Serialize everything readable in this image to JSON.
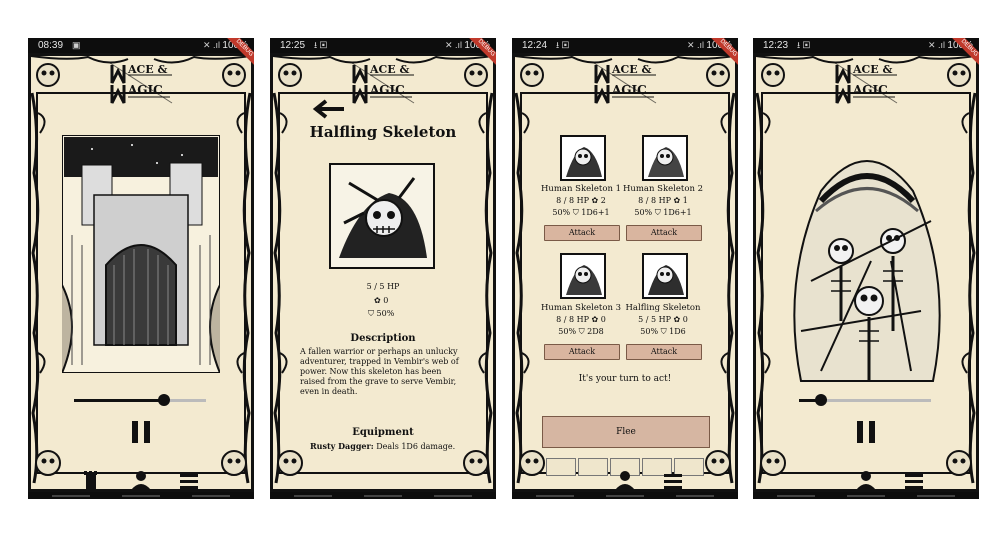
{
  "screens": [
    {
      "status": {
        "time": "08:39",
        "battery": "100%"
      },
      "debug": "DEBUG"
    },
    {
      "status": {
        "time": "12:25",
        "battery": "100%"
      },
      "debug": "DEBUG",
      "title": "Halfling Skeleton",
      "hp": "5 / 5 HP",
      "armor": "0",
      "dodge": "50%",
      "description_heading": "Description",
      "description": "A fallen warrior or perhaps an unlucky adventurer, trapped in Vembir's web of power. Now this skeleton has been raised from the grave to serve Vembir, even in death.",
      "equipment_heading": "Equipment",
      "equipment_name": "Rusty Dagger:",
      "equipment_effect": "Deals 1D6 damage."
    },
    {
      "status": {
        "time": "12:24",
        "battery": "100%"
      },
      "debug": "DEBUG",
      "enemies": [
        {
          "name": "Human Skeleton 1",
          "hp": "8 / 8 HP",
          "armor": "2",
          "dodge": "50%",
          "damage": "1D6+1",
          "button": "Attack"
        },
        {
          "name": "Human Skeleton 2",
          "hp": "8 / 8 HP",
          "armor": "1",
          "dodge": "50%",
          "damage": "1D6+1",
          "button": "Attack"
        },
        {
          "name": "Human Skeleton 3",
          "hp": "8 / 8 HP",
          "armor": "0",
          "dodge": "50%",
          "damage": "2D8",
          "button": "Attack"
        },
        {
          "name": "Halfling Skeleton",
          "hp": "5 / 5 HP",
          "armor": "0",
          "dodge": "50%",
          "damage": "1D6",
          "button": "Attack"
        }
      ],
      "turn_text": "It's your turn to act!",
      "flee_label": "Flee"
    },
    {
      "status": {
        "time": "12:23",
        "battery": "100%"
      },
      "debug": "DEBUG"
    }
  ],
  "logo": {
    "line1": "ACE &",
    "line2": "AGIC",
    "m": "M"
  },
  "music_slider": [
    0.68,
    0.17
  ],
  "colors": {
    "parchment": "#f3ead0",
    "button": "#d9b59f",
    "ink": "#111111"
  }
}
